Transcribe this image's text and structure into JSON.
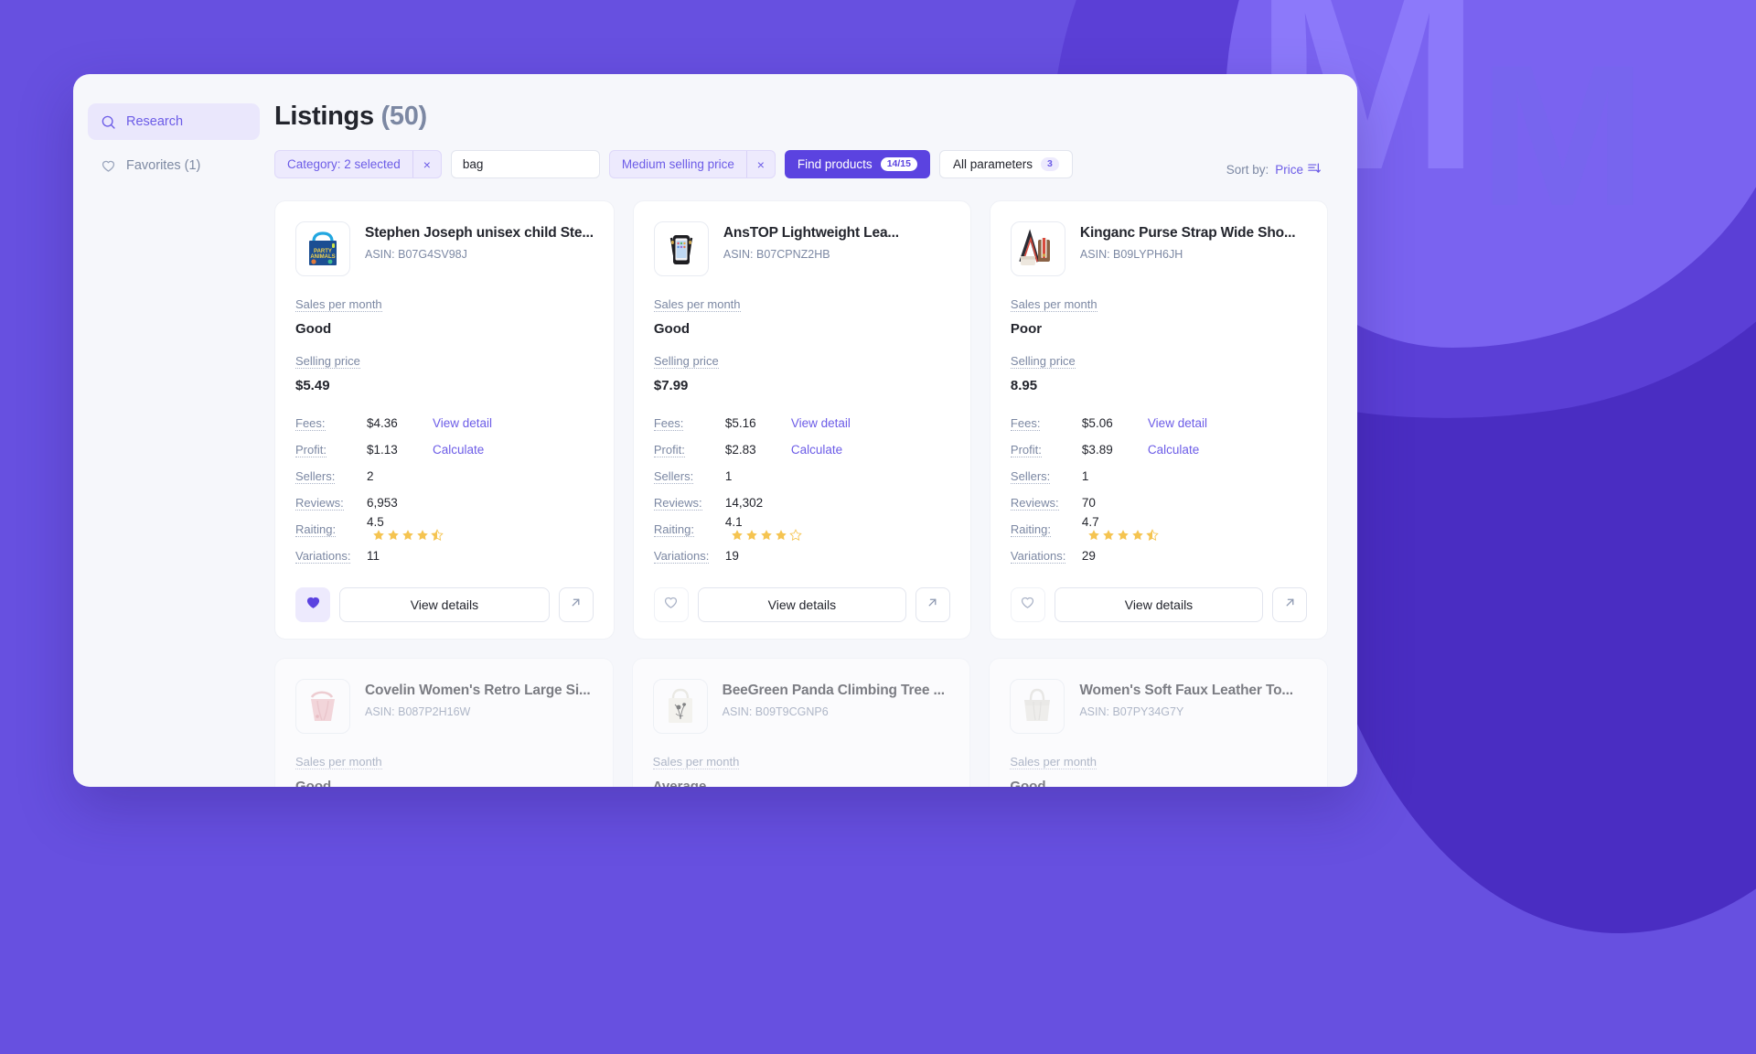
{
  "theme": {
    "brand": "#5B43E0",
    "brand_light": "#6C5CE7",
    "chip_bg": "#EDEAFD",
    "page_bg": "#6750E0",
    "star": "#F5C451"
  },
  "sidebar": {
    "items": [
      {
        "icon": "search-icon",
        "label": "Research",
        "active": true
      },
      {
        "icon": "heart-icon",
        "label": "Favorites (1)",
        "active": false
      }
    ]
  },
  "header": {
    "title": "Listings",
    "count": "(50)"
  },
  "filters": {
    "category_chip": {
      "label": "Category: 2 selected",
      "close": "×"
    },
    "search": {
      "value": "bag",
      "placeholder": "Search"
    },
    "price_chip": {
      "label": "Medium selling price",
      "close": "×"
    },
    "find_products": {
      "label": "Find products",
      "badge": "14/15"
    },
    "all_parameters": {
      "label": "All parameters",
      "badge": "3"
    },
    "sort": {
      "prefix": "Sort by:",
      "value": "Price"
    }
  },
  "labels": {
    "sales_per_month": "Sales per month",
    "selling_price": "Selling price",
    "fees": "Fees:",
    "profit": "Profit:",
    "sellers": "Sellers:",
    "reviews": "Reviews:",
    "rating": "Raiting:",
    "variations": "Variations:",
    "view_detail": "View detail",
    "calculate": "Calculate",
    "view_details": "View details",
    "asin_prefix": "ASIN: "
  },
  "cards": [
    {
      "thumb": "tote-bag-party-animals-icon",
      "title": "Stephen Joseph unisex child Ste...",
      "asin": "ASIN: B07G4SV98J",
      "sales_per_month": "Good",
      "selling_price": "$5.49",
      "fees": "$4.36",
      "profit": "$1.13",
      "sellers": "2",
      "reviews": "6,953",
      "rating": "4.5",
      "stars_full": 4,
      "stars_half": 1,
      "variations": "11",
      "favorited": true
    },
    {
      "thumb": "phone-crossbody-bag-icon",
      "title": "AnsTOP Lightweight Lea...",
      "asin": "ASIN: B07CPNZ2HB",
      "sales_per_month": "Good",
      "selling_price": "$7.99",
      "fees": "$5.16",
      "profit": "$2.83",
      "sellers": "1",
      "reviews": "14,302",
      "rating": "4.1",
      "stars_full": 4,
      "stars_half": 0,
      "variations": "19",
      "favorited": false
    },
    {
      "thumb": "purse-strap-icon",
      "title": "Kinganc Purse Strap Wide Sho...",
      "asin": "ASIN: B09LYPH6JH",
      "sales_per_month": "Poor",
      "selling_price": "8.95",
      "fees": "$5.06",
      "profit": "$3.89",
      "sellers": "1",
      "reviews": "70",
      "rating": "4.7",
      "stars_full": 4,
      "stars_half": 1,
      "variations": "29",
      "favorited": false
    }
  ],
  "cards_row2": [
    {
      "thumb": "pink-hobo-bag-icon",
      "title": "Covelin Women's Retro Large Si...",
      "asin": "ASIN: B087P2H16W",
      "sales_per_month": "Good",
      "selling_price": ""
    },
    {
      "thumb": "canvas-tote-panda-icon",
      "title": "BeeGreen Panda Climbing Tree ...",
      "asin": "ASIN: B09T9CGNP6",
      "sales_per_month": "Average",
      "selling_price": ""
    },
    {
      "thumb": "white-leather-tote-icon",
      "title": "Women's Soft Faux Leather To...",
      "asin": "ASIN: B07PY34G7Y",
      "sales_per_month": "Good",
      "selling_price": ""
    }
  ]
}
